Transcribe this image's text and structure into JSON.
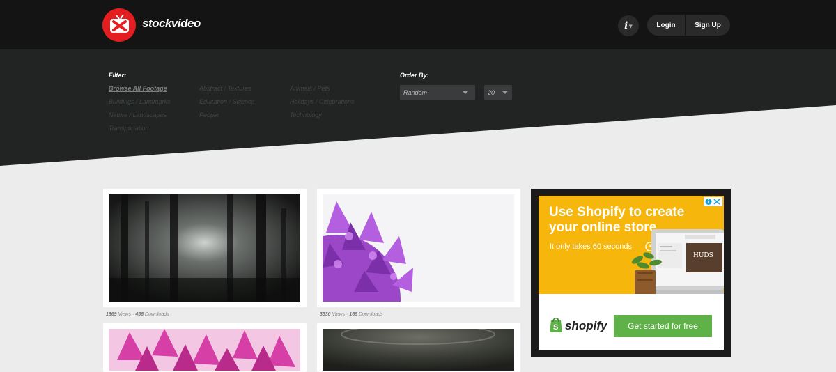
{
  "header": {
    "brand": "stockvideo",
    "info_label": "i",
    "login_label": "Login",
    "signup_label": "Sign Up"
  },
  "filter": {
    "title": "Filter:",
    "categories": [
      "Browse All Footage",
      "Abstract / Textures",
      "Animals / Pets",
      "Buildings / Landmarks",
      "Education / Science",
      "Holidays / Celebrations",
      "Nature / Landscapes",
      "People",
      "Technology",
      "Transportation"
    ]
  },
  "order": {
    "title": "Order By:",
    "sort_value": "Random",
    "count_value": "20"
  },
  "videos": [
    {
      "views": "1869",
      "views_label": "Views",
      "sep": "·",
      "downloads": "456",
      "downloads_label": "Downloads"
    },
    {
      "views": "3530",
      "views_label": "Views",
      "sep": "·",
      "downloads": "169",
      "downloads_label": "Downloads"
    }
  ],
  "ad": {
    "headline": "Use Shopify to create your online store",
    "subline": "It only takes 60 seconds",
    "brand": "shopify",
    "cta": "Get started for free",
    "laptop_text": "HUDS"
  },
  "colors": {
    "topbar": "#141414",
    "filterbar": "#222424",
    "logo_red": "#e41e20",
    "ad_yellow": "#f6b60b",
    "cta_green": "#5fb248"
  }
}
